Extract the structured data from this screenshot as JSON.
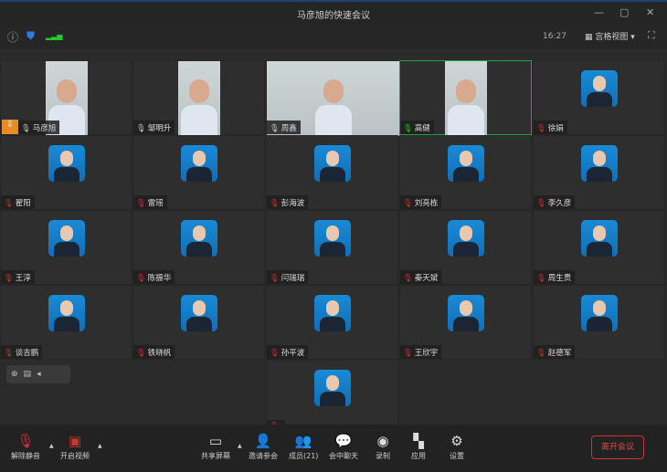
{
  "window": {
    "title": "马彦旭的快速会议",
    "minimize": "—",
    "maximize": "▢",
    "close": "✕"
  },
  "infobar": {
    "info_icon": "ⓘ",
    "shield_icon": "⛊",
    "signal_icon": "▂▃▅",
    "time": "16:27",
    "view_label": "宫格视图",
    "view_caret": "▾",
    "fullscreen_icon": "⛶"
  },
  "participants": [
    {
      "name": "马彦旭",
      "mic": "on",
      "video": true,
      "host": true
    },
    {
      "name": "邹明升",
      "mic": "on",
      "video": true
    },
    {
      "name": "周鑫",
      "mic": "on",
      "video": true
    },
    {
      "name": "高健",
      "mic": "green",
      "video": true,
      "active": true
    },
    {
      "name": "徐娟",
      "mic": "muted"
    },
    {
      "name": "翟阳",
      "mic": "muted"
    },
    {
      "name": "雷瑶",
      "mic": "muted"
    },
    {
      "name": "彭海波",
      "mic": "muted"
    },
    {
      "name": "刘亮栋",
      "mic": "muted"
    },
    {
      "name": "李久彦",
      "mic": "muted"
    },
    {
      "name": "王淳",
      "mic": "muted"
    },
    {
      "name": "陈振华",
      "mic": "muted"
    },
    {
      "name": "闫瑞瑞",
      "mic": "muted"
    },
    {
      "name": "秦天斌",
      "mic": "muted"
    },
    {
      "name": "周生贵",
      "mic": "muted"
    },
    {
      "name": "谈吉鹏",
      "mic": "muted"
    },
    {
      "name": "铁晓帆",
      "mic": "muted"
    },
    {
      "name": "孙平波",
      "mic": "muted"
    },
    {
      "name": "王欣宇",
      "mic": "muted"
    },
    {
      "name": "赵德军",
      "mic": "muted"
    },
    {
      "name": "",
      "mic": "muted"
    }
  ],
  "toolbar": {
    "unmute": "解除静音",
    "start_video": "开启视频",
    "share": "共享屏幕",
    "invite": "邀请参会",
    "members": "成员(21)",
    "chat": "会中聊天",
    "record": "录制",
    "apps": "应用",
    "settings": "设置",
    "leave": "离开会议"
  }
}
